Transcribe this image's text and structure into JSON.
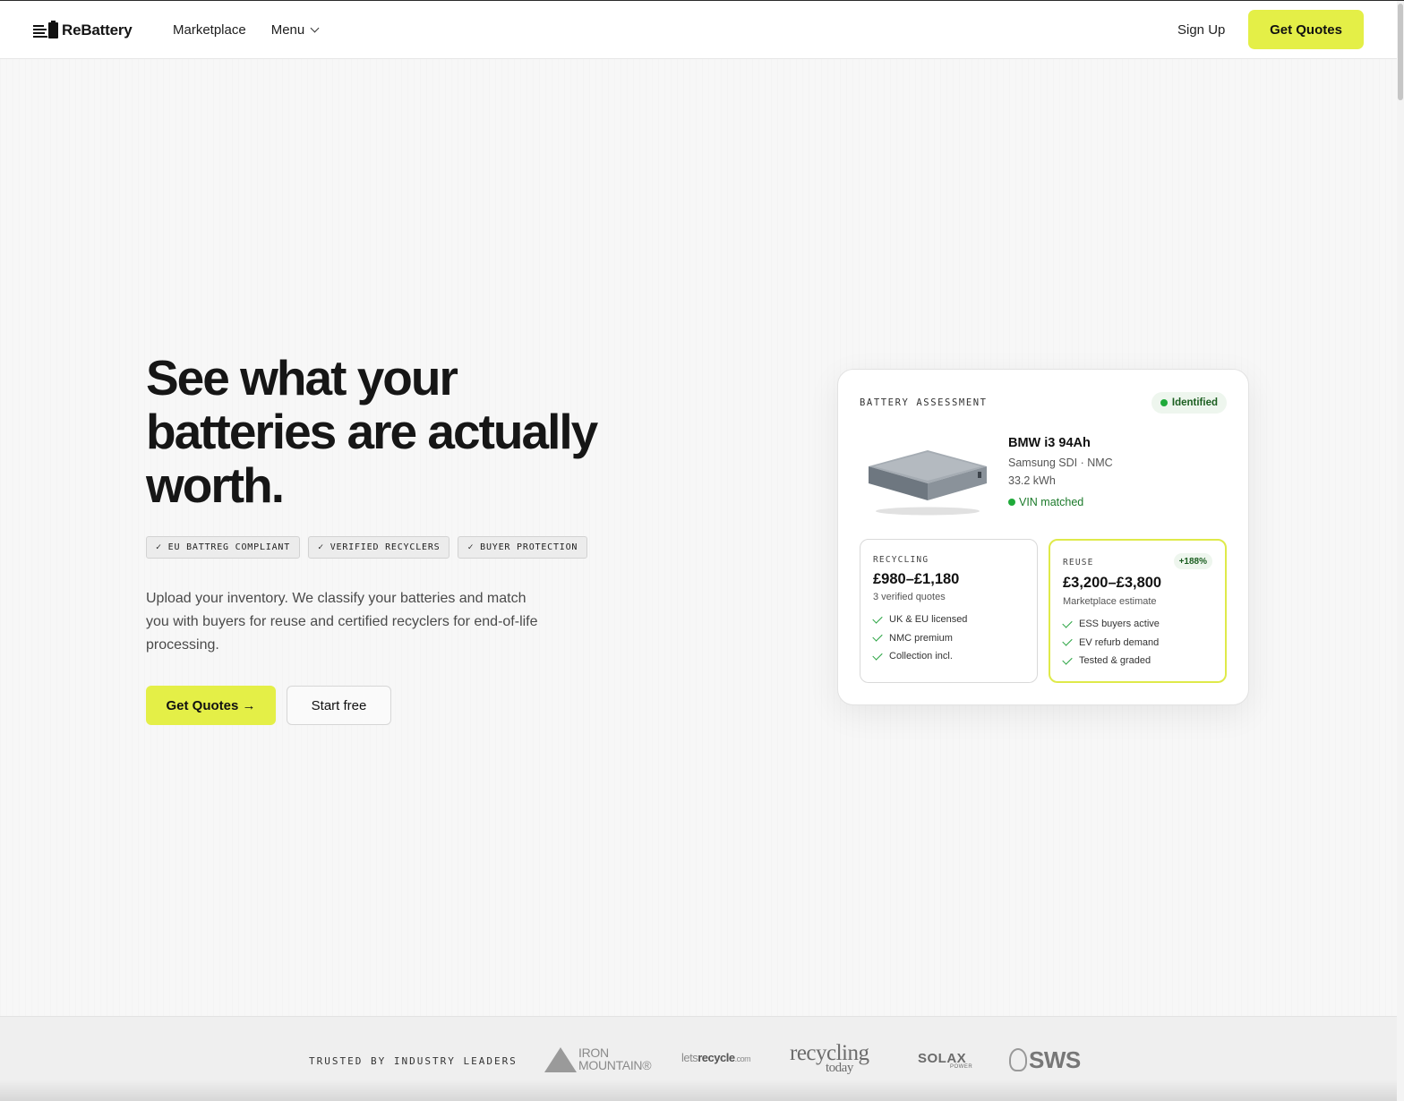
{
  "header": {
    "brand": "ReBattery",
    "nav": {
      "marketplace": "Marketplace",
      "menu": "Menu"
    },
    "sign_up": "Sign Up",
    "cta": "Get Quotes"
  },
  "hero": {
    "headline": "See what your batteries are actually worth.",
    "badges": [
      "✓ EU BATTREG COMPLIANT",
      "✓ VERIFIED RECYCLERS",
      "✓ BUYER PROTECTION"
    ],
    "description": "Upload your inventory. We classify your batteries and match you with buyers for reuse and certified recyclers for end-of-life processing.",
    "primary_cta": "Get Quotes →",
    "secondary_cta": "Start free"
  },
  "card": {
    "title": "BATTERY ASSESSMENT",
    "status": "Identified",
    "battery": {
      "name": "BMW i3 94Ah",
      "maker": "Samsung SDI · NMC",
      "capacity": "33.2 kWh",
      "vin": "VIN matched"
    },
    "recycling": {
      "label": "RECYCLING",
      "price": "£980–£1,180",
      "note": "3 verified quotes",
      "items": [
        "UK & EU licensed",
        "NMC premium",
        "Collection incl."
      ]
    },
    "reuse": {
      "label": "REUSE",
      "change": "+188%",
      "price": "£3,200–£3,800",
      "note": "Marketplace estimate",
      "items": [
        "ESS buyers active",
        "EV refurb demand",
        "Tested & graded"
      ]
    }
  },
  "trusted": {
    "label": "TRUSTED BY INDUSTRY LEADERS",
    "logos": {
      "iron_mountain_1": "IRON",
      "iron_mountain_2": "MOUNTAIN®",
      "letsrecycle_a": "lets",
      "letsrecycle_b": "recycle",
      "letsrecycle_c": ".com",
      "recycling_today_1": "recycling",
      "recycling_today_2": "today",
      "solax_1": "SOLAX",
      "solax_2": "POWER",
      "sws": "SWS"
    }
  },
  "colors": {
    "accent": "#e4ef47",
    "success": "#1faa3a",
    "background": "#f7f7f7"
  }
}
